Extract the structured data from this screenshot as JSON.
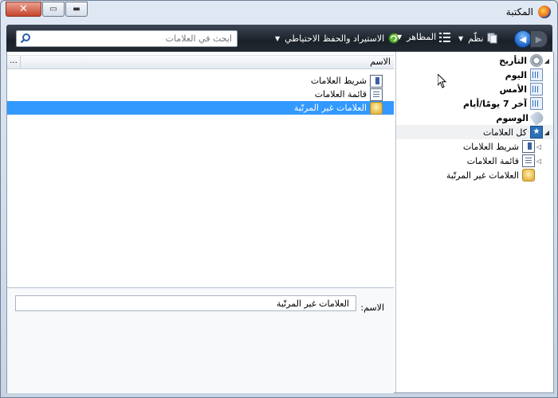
{
  "window": {
    "title": "المكتبة",
    "close_glyph": "✕",
    "maximize_glyph": "▭",
    "minimize_glyph": "▬"
  },
  "toolbar": {
    "back_icon": "back-arrow-icon",
    "forward_icon": "forward-arrow-icon",
    "organize_label": "نظّم",
    "views_label": "المظاهر",
    "import_backup_label": "الاستيراد والحفظ الاحتياطي",
    "search_placeholder": "ابحث في العلامات"
  },
  "sidebar": {
    "items": [
      {
        "label": "التأريخ",
        "icon": "history-icon",
        "expanded": true,
        "bold": true
      },
      {
        "label": "اليوم",
        "icon": "calendar-icon",
        "bold": true
      },
      {
        "label": "الأمس",
        "icon": "calendar-icon",
        "bold": true
      },
      {
        "label": "آخر 7 يومًا/أيام",
        "icon": "calendar-icon",
        "bold": true
      },
      {
        "label": "الوسوم",
        "icon": "tag-icon",
        "bold": true
      },
      {
        "label": "كل العلامات",
        "icon": "all-bookmarks-icon",
        "expanded": true,
        "bold": false
      },
      {
        "label": "شريط العلامات",
        "icon": "bookmarks-toolbar-icon",
        "collapsed": true
      },
      {
        "label": "قائمة العلامات",
        "icon": "bookmarks-menu-icon",
        "collapsed": true
      },
      {
        "label": "العلامات غير المرتّبة",
        "icon": "unsorted-bookmarks-icon"
      }
    ]
  },
  "list": {
    "column_name": "الاسم",
    "column_picker": "...",
    "rows": [
      {
        "label": "شريط العلامات",
        "icon": "bookmarks-toolbar-icon",
        "selected": false
      },
      {
        "label": "قائمة العلامات",
        "icon": "bookmarks-menu-icon",
        "selected": false
      },
      {
        "label": "العلامات غير المرتّبة",
        "icon": "unsorted-bookmarks-icon",
        "selected": true
      }
    ]
  },
  "details": {
    "name_label": "الاسم:",
    "name_value": "العلامات غير المرتّبة"
  },
  "colors": {
    "toolbar_bg": "#1b2129",
    "selection": "#3399ff",
    "window_frame": "#c7d4e4"
  }
}
